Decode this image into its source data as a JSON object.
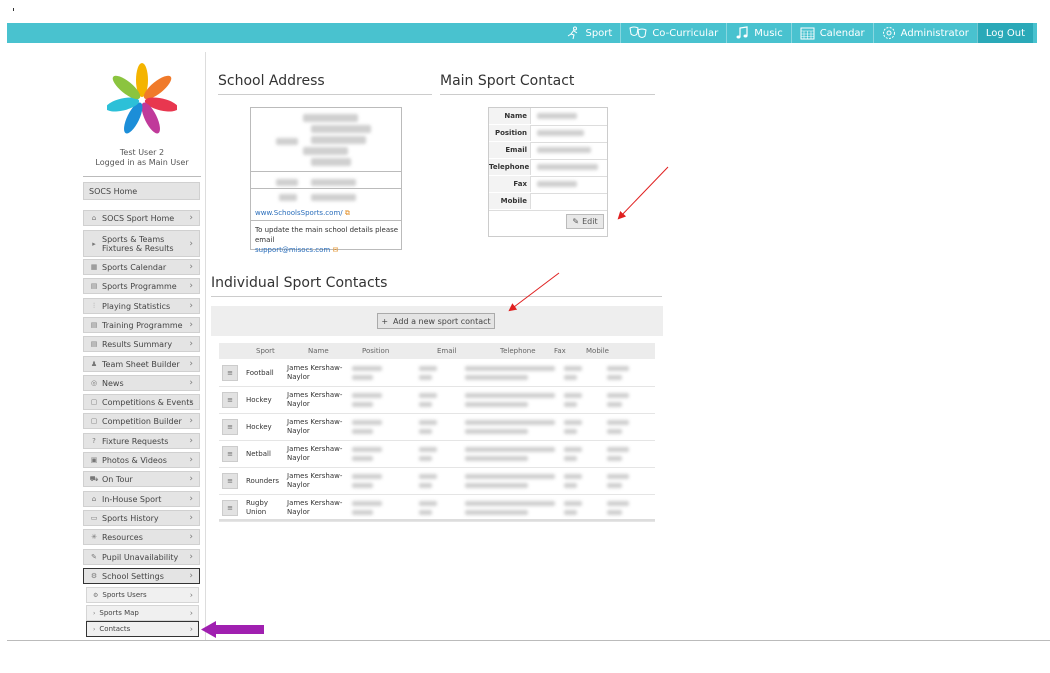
{
  "topnav": {
    "items": [
      {
        "label": "Sport",
        "icon": "runner-icon"
      },
      {
        "label": "Co-Curricular",
        "icon": "masks-icon"
      },
      {
        "label": "Music",
        "icon": "music-note-icon"
      },
      {
        "label": "Calendar",
        "icon": "calendar-icon"
      },
      {
        "label": "Administrator",
        "icon": "gear-icon"
      }
    ],
    "logout": "Log Out"
  },
  "user": {
    "name": "Test User 2",
    "role": "Logged in as Main User"
  },
  "sidebar": {
    "home": "SOCS Home",
    "items": [
      {
        "label": "SOCS Sport Home",
        "icon": "⌂"
      },
      {
        "label": "Sports & Teams Fixtures & Results",
        "icon": "▸"
      },
      {
        "label": "Sports Calendar",
        "icon": "▦"
      },
      {
        "label": "Sports Programme",
        "icon": "▤"
      },
      {
        "label": "Playing Statistics",
        "icon": "⫶"
      },
      {
        "label": "Training Programme",
        "icon": "▤"
      },
      {
        "label": "Results Summary",
        "icon": "▤"
      },
      {
        "label": "Team Sheet Builder",
        "icon": "♟"
      },
      {
        "label": "News",
        "icon": "◎"
      },
      {
        "label": "Competitions & Events",
        "icon": "▢"
      },
      {
        "label": "Competition Builder",
        "icon": "▢"
      },
      {
        "label": "Fixture Requests",
        "icon": "?"
      },
      {
        "label": "Photos & Videos",
        "icon": "▣"
      },
      {
        "label": "On Tour",
        "icon": "⛟"
      },
      {
        "label": "In-House Sport",
        "icon": "⌂"
      },
      {
        "label": "Sports History",
        "icon": "▭"
      },
      {
        "label": "Resources",
        "icon": "✳"
      },
      {
        "label": "Pupil Unavailability",
        "icon": "✎"
      },
      {
        "label": "School Settings",
        "icon": "⚙"
      }
    ],
    "subitems": [
      {
        "label": "Sports Users",
        "icon": "⚙"
      },
      {
        "label": "Sports Map",
        "icon": "›"
      },
      {
        "label": "Contacts",
        "icon": "›"
      }
    ]
  },
  "school_address": {
    "title": "School Address",
    "website": "www.SchoolsSports.com/",
    "note": "To update the main school details please email",
    "email": "support@misocs.com"
  },
  "main_contact": {
    "title": "Main Sport Contact",
    "labels": [
      "Name",
      "Position",
      "Email",
      "Telephone",
      "Fax",
      "Mobile"
    ],
    "edit": "Edit"
  },
  "sport_contacts": {
    "title": "Individual Sport Contacts",
    "add_button": "Add a new sport contact",
    "columns": [
      "Sport",
      "Name",
      "Position",
      "Email",
      "Telephone",
      "Fax",
      "Mobile"
    ],
    "rows": [
      {
        "sport": "Football",
        "name": "James Kershaw-Naylor"
      },
      {
        "sport": "Hockey",
        "name": "James Kershaw-Naylor"
      },
      {
        "sport": "Hockey",
        "name": "James Kershaw-Naylor"
      },
      {
        "sport": "Netball",
        "name": "James Kershaw-Naylor"
      },
      {
        "sport": "Rounders",
        "name": "James Kershaw-Naylor"
      },
      {
        "sport": "Rugby Union",
        "name": "James Kershaw-Naylor"
      }
    ]
  },
  "colors": {
    "topbar": "#49c2cf",
    "annotation_red": "#e02020",
    "annotation_purple": "#a020b0"
  }
}
